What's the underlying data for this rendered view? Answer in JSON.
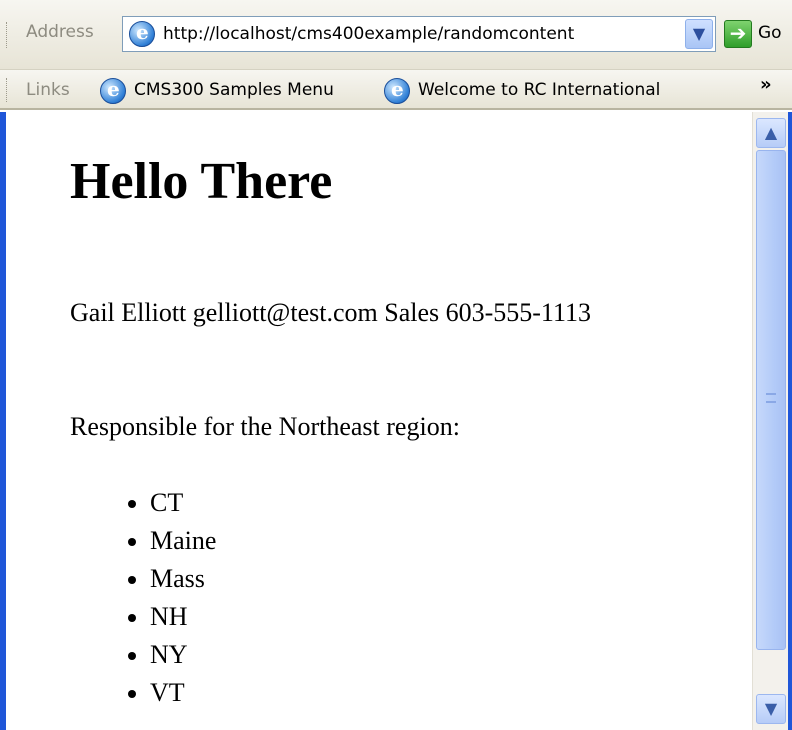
{
  "toolbar": {
    "address_label": "Address",
    "address_url": "http://localhost/cms400example/randomcontent",
    "go_label": "Go",
    "links_label": "Links",
    "links": [
      {
        "label": "CMS300 Samples Menu",
        "icon": "ie-page-icon"
      },
      {
        "label": "Welcome to RC International",
        "icon": "ie-page-icon"
      }
    ],
    "overflow_glyph": "»"
  },
  "page": {
    "heading": "Hello There",
    "contact": "Gail Elliott gelliott@test.com Sales 603-555-1113",
    "region_text": "Responsible for the Northeast region:",
    "states": [
      "CT",
      "Maine",
      "Mass",
      "NH",
      "NY",
      "VT"
    ]
  },
  "colors": {
    "frame_border": "#1f56d8",
    "toolbar_bg": "#ece9d8",
    "scrollbar_thumb": "#b6ccf7",
    "go_arrow": "#2f9e2a"
  }
}
